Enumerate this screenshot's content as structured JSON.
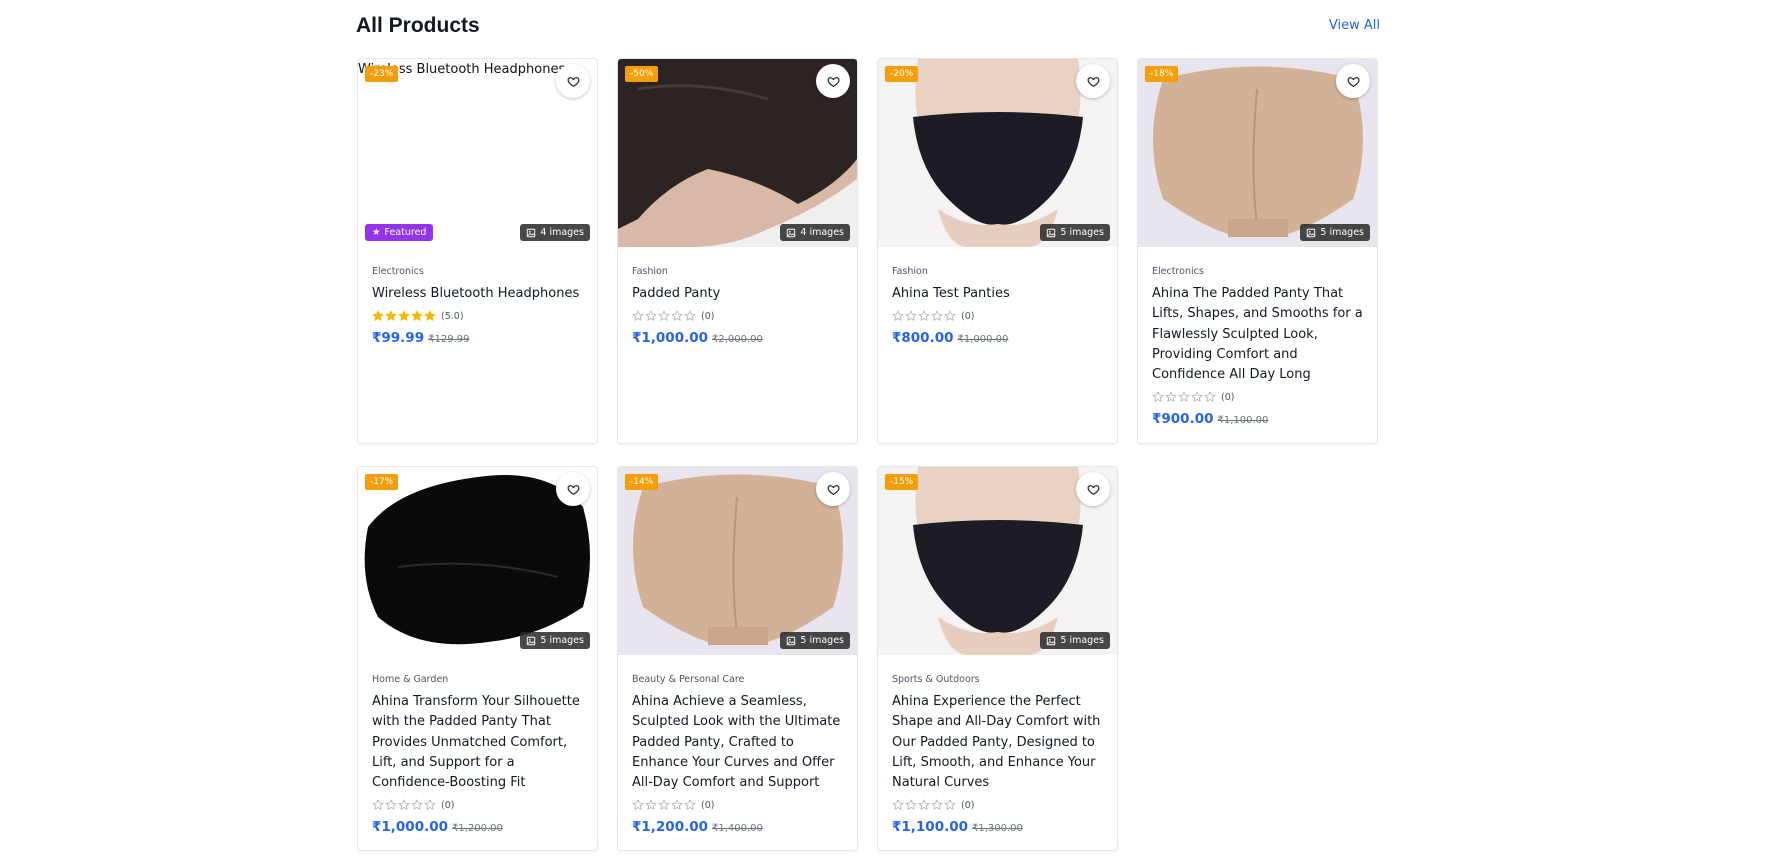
{
  "section": {
    "title": "All Products",
    "view_all": "View All"
  },
  "products": [
    {
      "discount": "-23%",
      "image_count": "4 images",
      "featured": "Featured",
      "image_alt": "Wireless Bluetooth Headphones",
      "category": "Electronics",
      "title": "Wireless Bluetooth Headphones",
      "rating_count": "(5.0)",
      "rating_value": 5,
      "price": "₹99.99",
      "old_price": "₹129.99"
    },
    {
      "discount": "-50%",
      "image_count": "4 images",
      "category": "Fashion",
      "title": "Padded Panty",
      "rating_count": "(0)",
      "rating_value": 0,
      "price": "₹1,000.00",
      "old_price": "₹2,000.00"
    },
    {
      "discount": "-20%",
      "image_count": "5 images",
      "category": "Fashion",
      "title": "Ahina Test Panties",
      "rating_count": "(0)",
      "rating_value": 0,
      "price": "₹800.00",
      "old_price": "₹1,000.00"
    },
    {
      "discount": "-18%",
      "image_count": "5 images",
      "category": "Electronics",
      "title": "Ahina The Padded Panty That Lifts, Shapes, and Smooths for a Flawlessly Sculpted Look, Providing Comfort and Confidence All Day Long",
      "rating_count": "(0)",
      "rating_value": 0,
      "price": "₹900.00",
      "old_price": "₹1,100.00"
    },
    {
      "discount": "-17%",
      "image_count": "5 images",
      "category": "Home & Garden",
      "title": "Ahina Transform Your Silhouette with the Padded Panty That Provides Unmatched Comfort, Lift, and Support for a Confidence-Boosting Fit",
      "rating_count": "(0)",
      "rating_value": 0,
      "price": "₹1,000.00",
      "old_price": "₹1,200.00"
    },
    {
      "discount": "-14%",
      "image_count": "5 images",
      "category": "Beauty & Personal Care",
      "title": "Ahina Achieve a Seamless, Sculpted Look with the Ultimate Padded Panty, Crafted to Enhance Your Curves and Offer All-Day Comfort and Support",
      "rating_count": "(0)",
      "rating_value": 0,
      "price": "₹1,200.00",
      "old_price": "₹1,400.00"
    },
    {
      "discount": "-15%",
      "image_count": "5 images",
      "category": "Sports & Outdoors",
      "title": "Ahina Experience the Perfect Shape and All-Day Comfort with Our Padded Panty, Designed to Lift, Smooth, and Enhance Your Natural Curves",
      "rating_count": "(0)",
      "rating_value": 0,
      "price": "₹1,100.00",
      "old_price": "₹1,300.00"
    }
  ]
}
